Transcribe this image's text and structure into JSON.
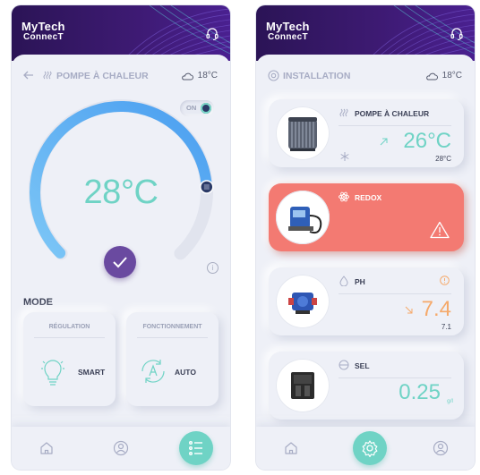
{
  "app": {
    "logo_line1": "MyTech",
    "logo_line2": "ConnecT"
  },
  "screen_left": {
    "title": "POMPE À CHALEUR",
    "outdoor_temp": "18°C",
    "power_toggle": {
      "label": "ON",
      "state": true
    },
    "setpoint": "28°C",
    "setpoint_level": 0.82,
    "mode_title": "MODE",
    "regulation": {
      "title": "RÉGULATION",
      "value": "SMART",
      "icon": "lightbulb-icon"
    },
    "operation": {
      "title": "FONCTIONNEMENT",
      "value": "AUTO",
      "icon": "auto-cycle-icon"
    },
    "nav": [
      "home-icon",
      "user-icon",
      "list-icon"
    ],
    "nav_active": "list-icon"
  },
  "screen_right": {
    "title": "INSTALLATION",
    "outdoor_temp": "18°C",
    "equipment": [
      {
        "name": "POMPE À CHALEUR",
        "icon": "heat-waves-icon",
        "value": "26°C",
        "target": "28°C",
        "trend": "up",
        "status_icon": "snowflake-icon",
        "value_color": "#6fd3c5"
      },
      {
        "name": "REDOX",
        "icon": "atom-icon",
        "value": "",
        "status_icon": "warning-icon",
        "alert": true
      },
      {
        "name": "PH",
        "icon": "drop-icon",
        "value": "7.4",
        "target": "7.1",
        "trend": "down",
        "status_icon": "alert-circle-icon",
        "value_color": "#f5a96a"
      },
      {
        "name": "SEL",
        "icon": "salt-icon",
        "value": "0.25",
        "unit": "g/l",
        "value_color": "#6fd3c5"
      }
    ],
    "nav": [
      "home-icon",
      "settings-icon",
      "user-icon"
    ],
    "nav_active": "settings-icon"
  },
  "colors": {
    "header": "#2b1456",
    "accent": "#6fd3c5",
    "alert": "#f37a72",
    "confirm": "#6a4aa0",
    "orange": "#f5a96a"
  }
}
